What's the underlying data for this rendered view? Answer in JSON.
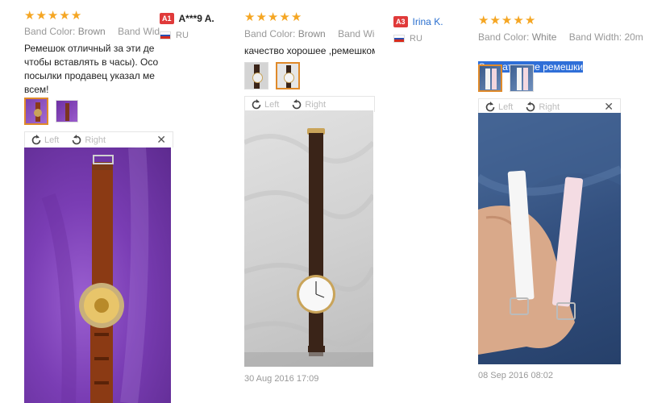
{
  "stars": [
    "★",
    "★",
    "★",
    "★",
    "★"
  ],
  "labels": {
    "band_color": "Band Color:",
    "band_width": "Band Width:",
    "band_width_cut": "Band Wid",
    "band_width_cut3": "Band Width: 20m",
    "rotate_left": "Left",
    "rotate_right": "Right",
    "close": "✕"
  },
  "reviews": [
    {
      "band_color": "Brown",
      "text": "Ремешок отличный за эти де\nчтобы вставлять в часы). Осо\nпосылки продавец указал ме\nвсем!"
    },
    {
      "author_badge": "A1",
      "author": "A***9 A.",
      "country": "RU",
      "band_color": "Brown",
      "text": "качество хорошее ,ремешком",
      "date": "30 Aug 2016 17:09"
    },
    {
      "author_badge": "A3",
      "author": "Irina K.",
      "country": "RU",
      "band_color": "White",
      "text": "Симпатичные ремешки",
      "date": "08 Sep 2016 08:02"
    }
  ],
  "colors": {
    "star": "#f5a623",
    "badge": "#e03a3a",
    "highlight": "#2f6fd8",
    "thumb_active_border": "#e08a2a"
  }
}
